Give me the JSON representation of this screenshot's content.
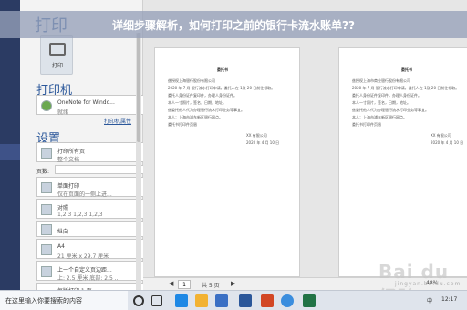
{
  "banner": {
    "text": "详细步骤解析，如何打印之前的银行卡流水账单??"
  },
  "panel": {
    "title": "打印",
    "print_button_label": "打印",
    "printer_section": "打印机",
    "printer_name": "OneNote for Windo...",
    "printer_status": "就绪",
    "printer_props_link": "打印机属性",
    "settings_section": "设置",
    "options": [
      {
        "line1": "打印所有页",
        "line2": "整个文档"
      },
      {
        "line1": "单面打印",
        "line2": "仅在页面的一侧上进..."
      },
      {
        "line1": "对照",
        "line2": "1,2,3    1,2,3    1,2,3"
      },
      {
        "line1": "纵向",
        "line2": ""
      },
      {
        "line1": "A4",
        "line2": "21 厘米 x 29.7 厘米"
      },
      {
        "line1": "上一个自定义页边距...",
        "line2": "上: 2.5 厘米 底部: 2.5 ..."
      },
      {
        "line1": "每版打印 1 页",
        "line2": ""
      }
    ],
    "pages_label": "页数:"
  },
  "doc_pages": [
    {
      "title": "委托书",
      "lines": [
        "兹授权上海银行股份有限公司",
        "2020 年 7 月    银行流水打印申请，委托人在 1及 20 日前往领取。",
        "    委托人身份证件复印件，办理人身份证件。",
        "    本人一寸照片，签名，日期，地址。",
        "    兹委托他人代为办理银行流水打印业务等事宜。",
        "    本人：上海市浦东新区银行网点。",
        "    委托书打印件页眉"
      ],
      "sign1": "XX 有限公司",
      "sign2": "2020 年 4 月 10 日"
    },
    {
      "title": "委托书",
      "lines": [
        "兹授权上海市商业银行股份有限公司",
        "2020 年 7 月    银行流水打印申请，委托人在 1及 20 日前往领取。",
        "    委托人身份证件复印件，办理人身份证件。",
        "    本人一寸照片，签名，日期，地址。",
        "    兹委托他人代为办理银行流水打印业务等事宜。",
        "    本人：上海市浦东新区银行网点。",
        "    委托书打印件页眉"
      ],
      "sign1": "XX 有限公司",
      "sign2": "2020 年 4 月 10 日"
    }
  ],
  "pager": {
    "current": "1",
    "of_text": "共 5 页"
  },
  "zoom": "48%",
  "watermark": {
    "main": "Bai du 经验",
    "sub": "jingyan.baidu.com"
  },
  "taskbar": {
    "search_text": "在这里输入你要搜索的内容",
    "tray_lang": "中",
    "time": "12:17"
  }
}
